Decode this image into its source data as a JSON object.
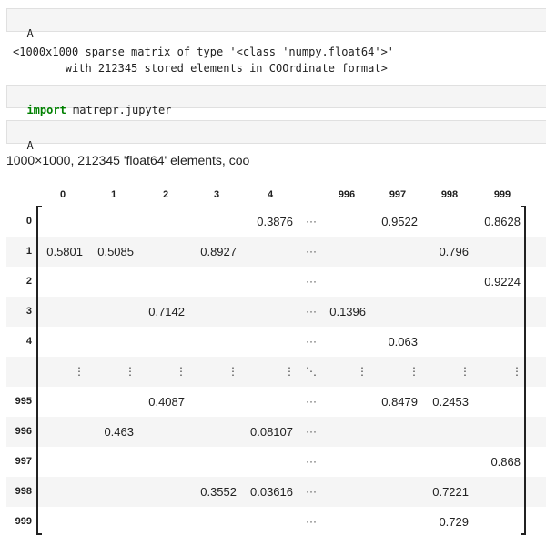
{
  "cells": {
    "cell1_input": "A",
    "cell1_output_line1": "<1000x1000 sparse matrix of type '<class 'numpy.float64'>'",
    "cell1_output_line2": "        with 212345 stored elements in COOrdinate format>",
    "cell2_keyword": "import",
    "cell2_rest": " matrepr.jupyter",
    "cell3_input": "A",
    "cell3_summary": "1000×1000, 212345 'float64' elements, coo"
  },
  "matrix": {
    "col_headers": [
      "0",
      "1",
      "2",
      "3",
      "4",
      "",
      "996",
      "997",
      "998",
      "999"
    ],
    "row_headers": [
      "0",
      "1",
      "2",
      "3",
      "4",
      "",
      "995",
      "996",
      "997",
      "998",
      "999"
    ],
    "vdots": "⋮",
    "hdots": "···",
    "ddots": "⋱",
    "rows": [
      [
        "",
        "",
        "",
        "",
        "0.3876",
        "",
        "0.9522",
        "",
        "0.8628"
      ],
      [
        "0.5801",
        "0.5085",
        "",
        "0.8927",
        "",
        "",
        "",
        "0.796",
        ""
      ],
      [
        "",
        "",
        "",
        "",
        "",
        "",
        "",
        "",
        "0.9224"
      ],
      [
        "",
        "",
        "0.7142",
        "",
        "",
        "0.1396",
        "",
        "",
        ""
      ],
      [
        "",
        "",
        "",
        "",
        "",
        "",
        "0.063",
        "",
        ""
      ],
      null,
      [
        "",
        "",
        "0.4087",
        "",
        "",
        "",
        "0.8479",
        "0.2453",
        ""
      ],
      [
        "",
        "0.463",
        "",
        "",
        "0.08107",
        "",
        "",
        "",
        ""
      ],
      [
        "",
        "",
        "",
        "",
        "",
        "",
        "",
        "",
        "0.868"
      ],
      [
        "",
        "",
        "",
        "0.3552",
        "0.03616",
        "",
        "",
        "0.7221",
        ""
      ],
      [
        "",
        "",
        "",
        "",
        "",
        "",
        "",
        "0.729",
        ""
      ]
    ]
  }
}
